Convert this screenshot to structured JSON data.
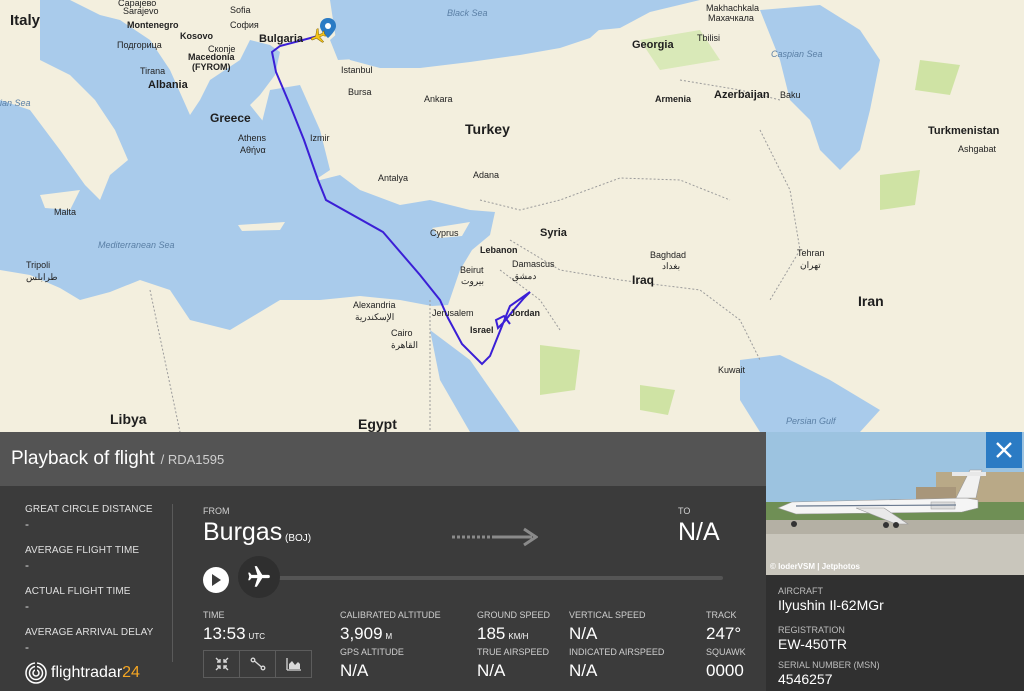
{
  "map": {
    "labels": {
      "italy": "Italy",
      "sarajevo": "Sarajevo",
      "sarajevo_local": "Сарајево",
      "montenegro": "Montenegro",
      "podgorica": "Подгорица",
      "kosovo": "Kosovo",
      "macedonia": "Macedonia",
      "fyrom": "(FYROM)",
      "skopje": "Скопје",
      "sofia": "Sofia",
      "sofia_local": "София",
      "bulgaria": "Bulgaria",
      "black_sea": "Black Sea",
      "tirana": "Tirana",
      "albania": "Albania",
      "greece": "Greece",
      "athens": "Athens",
      "athens_local": "Αθήνα",
      "istanbul": "Istanbul",
      "bursa": "Bursa",
      "ankara": "Ankara",
      "izmir": "Izmir",
      "turkey": "Turkey",
      "antalya": "Antalya",
      "adana": "Adana",
      "malta": "Malta",
      "mediterranean_sea": "Mediterranean Sea",
      "ian_sea": "ian Sea",
      "cyprus": "Cyprus",
      "syria": "Syria",
      "lebanon": "Lebanon",
      "beirut": "Beirut",
      "beirut_local": "بيروت",
      "damascus": "Damascus",
      "damascus_local": "دمشق",
      "tripoli": "Tripoli",
      "tripoli_local": "طرابلس",
      "alexandria": "Alexandria",
      "alexandria_local": "الإسكندرية",
      "jerusalem": "Jerusalem",
      "israel": "Israel",
      "jordan": "Jordan",
      "cairo": "Cairo",
      "cairo_local": "القاهرة",
      "libya": "Libya",
      "egypt": "Egypt",
      "baghdad": "Baghdad",
      "baghdad_local": "بغداد",
      "iraq": "Iraq",
      "iran": "Iran",
      "kuwait": "Kuwait",
      "persian_gulf": "Persian Gulf",
      "tehran": "Tehran",
      "tehran_local": "تهران",
      "georgia": "Georgia",
      "tbilisi": "Tbilisi",
      "armenia": "Armenia",
      "azerbaijan": "Azerbaijan",
      "baku": "Baku",
      "caspian_sea": "Caspian Sea",
      "turkmenistan": "Turkmenistan",
      "ashgabat": "Ashgabat",
      "makhachkala": "Makhachkala",
      "makhachkala_local": "Махачкала"
    }
  },
  "panel": {
    "title": "Playback of flight",
    "flight_id": "/ RDA1595",
    "stats": [
      {
        "label": "GREAT CIRCLE DISTANCE",
        "value": "-"
      },
      {
        "label": "AVERAGE FLIGHT TIME",
        "value": "-"
      },
      {
        "label": "ACTUAL FLIGHT TIME",
        "value": "-"
      },
      {
        "label": "AVERAGE ARRIVAL DELAY",
        "value": "-"
      }
    ],
    "from_label": "FROM",
    "from_city": "Burgas",
    "from_code": "(BOJ)",
    "to_label": "TO",
    "to_value": "N/A",
    "time_label": "TIME",
    "time_value": "13:53",
    "time_unit": "UTC",
    "cal_alt_label": "CALIBRATED ALTITUDE",
    "cal_alt_value": "3,909",
    "cal_alt_unit": "M",
    "gps_alt_label": "GPS ALTITUDE",
    "gps_alt_value": "N/A",
    "ground_speed_label": "GROUND SPEED",
    "ground_speed_value": "185",
    "ground_speed_unit": "KM/H",
    "true_airspeed_label": "TRUE AIRSPEED",
    "true_airspeed_value": "N/A",
    "vertical_speed_label": "VERTICAL SPEED",
    "vertical_speed_value": "N/A",
    "indicated_airspeed_label": "INDICATED AIRSPEED",
    "indicated_airspeed_value": "N/A",
    "track_label": "TRACK",
    "track_value": "247°",
    "squawk_label": "SQUAWK",
    "squawk_value": "0000",
    "logo_main": "flightradar",
    "logo_accent": "24"
  },
  "aircraft": {
    "photo_credit": "© loderVSM | Jetphotos",
    "aircraft_label": "AIRCRAFT",
    "aircraft_value": "Ilyushin Il-62MGr",
    "registration_label": "REGISTRATION",
    "registration_value": "EW-450TR",
    "serial_label": "SERIAL NUMBER (MSN)",
    "serial_value": "4546257"
  },
  "colors": {
    "flight_path": "#3b1fd6",
    "sea": "#a9cbeb",
    "land": "#f3efde",
    "green_land": "#cfe3a4",
    "accent_blue": "#2b7bc4",
    "logo_accent": "#f5a623"
  }
}
